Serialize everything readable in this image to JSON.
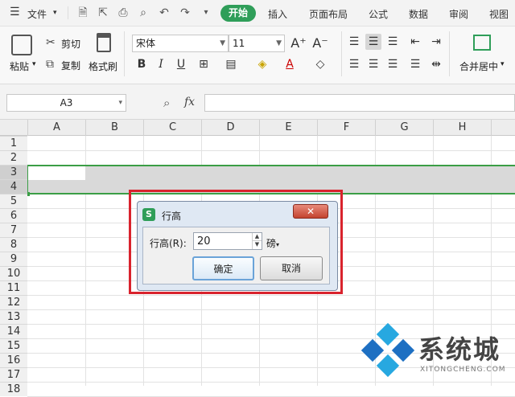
{
  "menu": {
    "file_label": "文件",
    "tabs": [
      "开始",
      "插入",
      "页面布局",
      "公式",
      "数据",
      "审阅",
      "视图"
    ]
  },
  "ribbon": {
    "paste": "粘贴",
    "cut": "剪切",
    "copy": "复制",
    "format_painter": "格式刷",
    "font_name": "宋体",
    "font_size": "11",
    "merge_center": "合并居中"
  },
  "formula_bar": {
    "cell_ref": "A3",
    "fx": "fx",
    "value": ""
  },
  "grid": {
    "columns": [
      "A",
      "B",
      "C",
      "D",
      "E",
      "F",
      "G",
      "H"
    ],
    "rows": [
      "1",
      "2",
      "3",
      "4",
      "5",
      "6",
      "7",
      "8",
      "9",
      "10",
      "11",
      "12",
      "13",
      "14",
      "15",
      "16",
      "17",
      "18"
    ]
  },
  "dialog": {
    "title": "行高",
    "field_label": "行高(R):",
    "value": "20",
    "unit": "磅",
    "ok": "确定",
    "cancel": "取消"
  },
  "watermark": {
    "name": "系统城",
    "url": "XITONGCHENG.COM"
  },
  "colors": {
    "accent": "#2f9e59",
    "highlight_box": "#d9232d",
    "selection": "#3b9e46"
  }
}
